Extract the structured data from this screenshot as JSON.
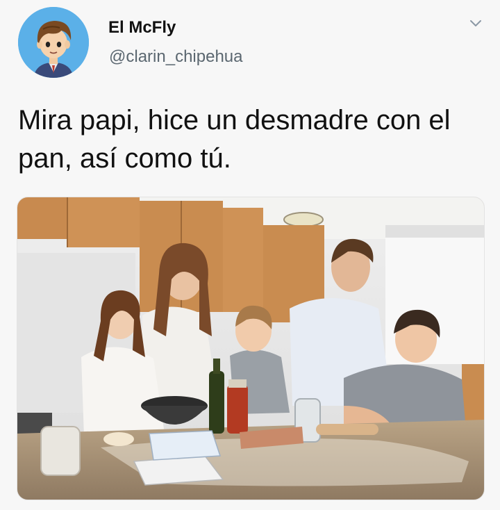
{
  "tweet": {
    "author": {
      "display_name": "El McFly",
      "handle": "@clarin_chipehua"
    },
    "text": "Mira papi, hice un desmadre con el pan, así como tú.",
    "menu_icon": "chevron-down-icon",
    "media": {
      "icon": "photo"
    }
  },
  "colors": {
    "avatar_bg": "#5bb0e8",
    "handle": "#5b6770"
  }
}
